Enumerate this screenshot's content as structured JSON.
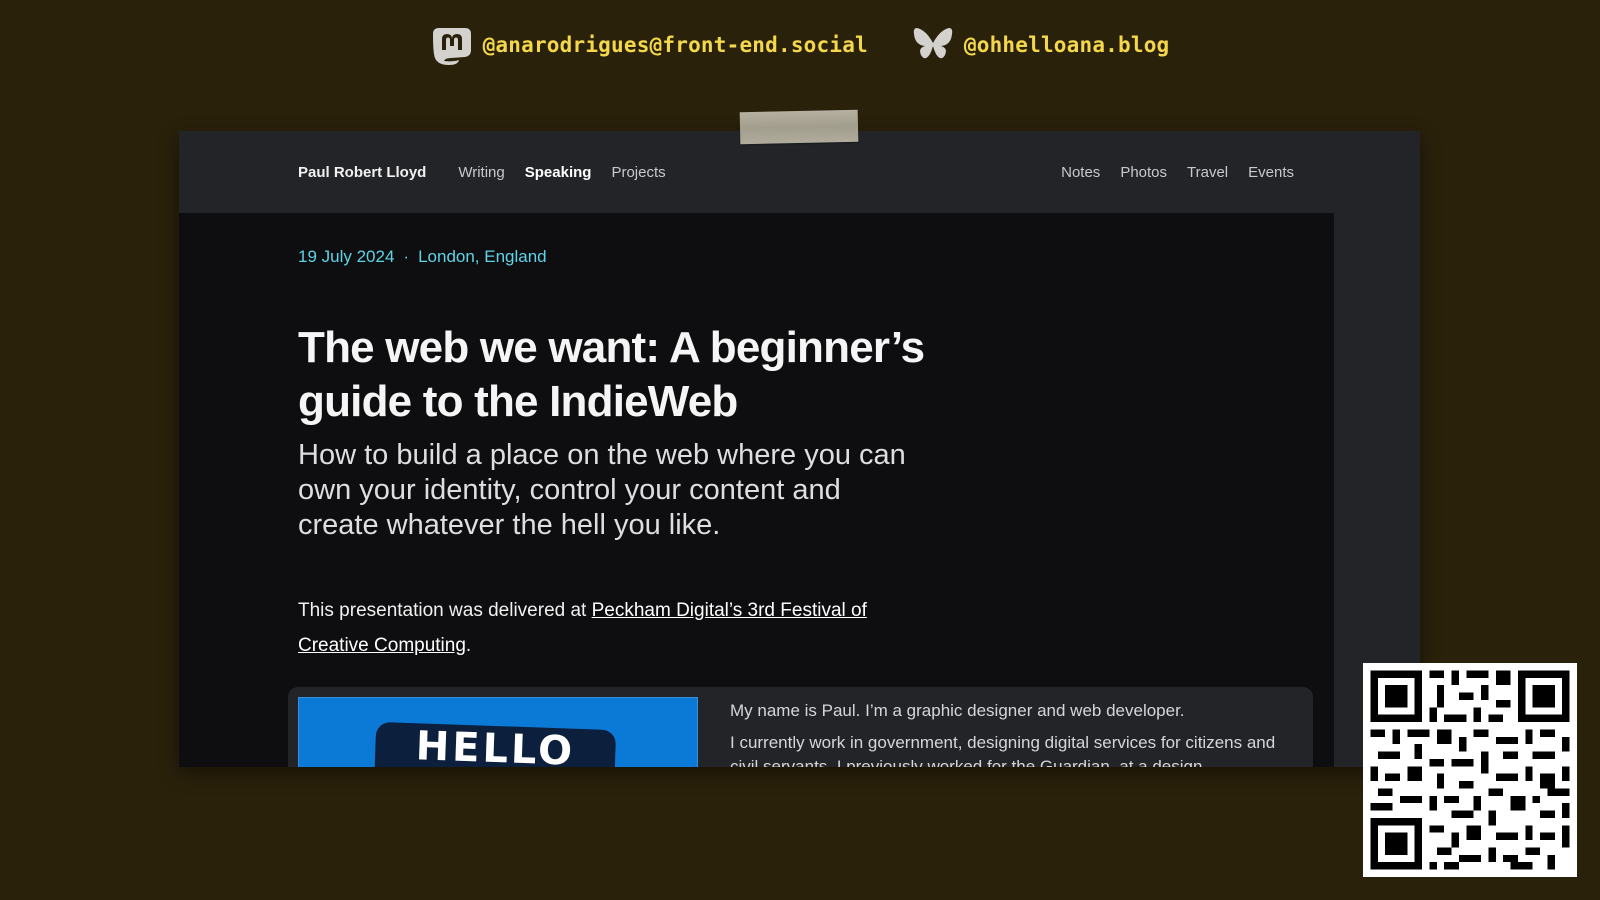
{
  "socials": [
    {
      "icon": "mastodon-icon",
      "handle": "@anarodrigues@front-end.social"
    },
    {
      "icon": "bluesky-icon",
      "handle": "@ohhelloana.blog"
    }
  ],
  "site": {
    "name": "Paul Robert Lloyd",
    "nav_left": [
      "Writing",
      "Speaking",
      "Projects"
    ],
    "nav_right": [
      "Notes",
      "Photos",
      "Travel",
      "Events"
    ],
    "active": "Speaking"
  },
  "article": {
    "date": "19 July 2024",
    "separator": "·",
    "location": "London, England",
    "title": "The web we want: A beginner’s guide to the IndieWeb",
    "subtitle": "How to build a place on the web where you can own your identity, control your content and create whatever the hell you like.",
    "intro_prefix": "This presentation was delivered at ",
    "intro_link": "Peckham Digital’s 3rd Festival of Creative Computing",
    "intro_suffix": "."
  },
  "card": {
    "image_text": "HELLO",
    "bio_1": "My name is Paul. I’m a graphic designer and web developer.",
    "bio_2": "I currently work in government, designing digital services for citizens and civil servants. I previously worked for the Guardian, at a design"
  },
  "colors": {
    "background": "#2a210b",
    "handle": "#f5d84a",
    "meta": "#5fd4e6",
    "hello_blue": "#0b7ad6"
  }
}
